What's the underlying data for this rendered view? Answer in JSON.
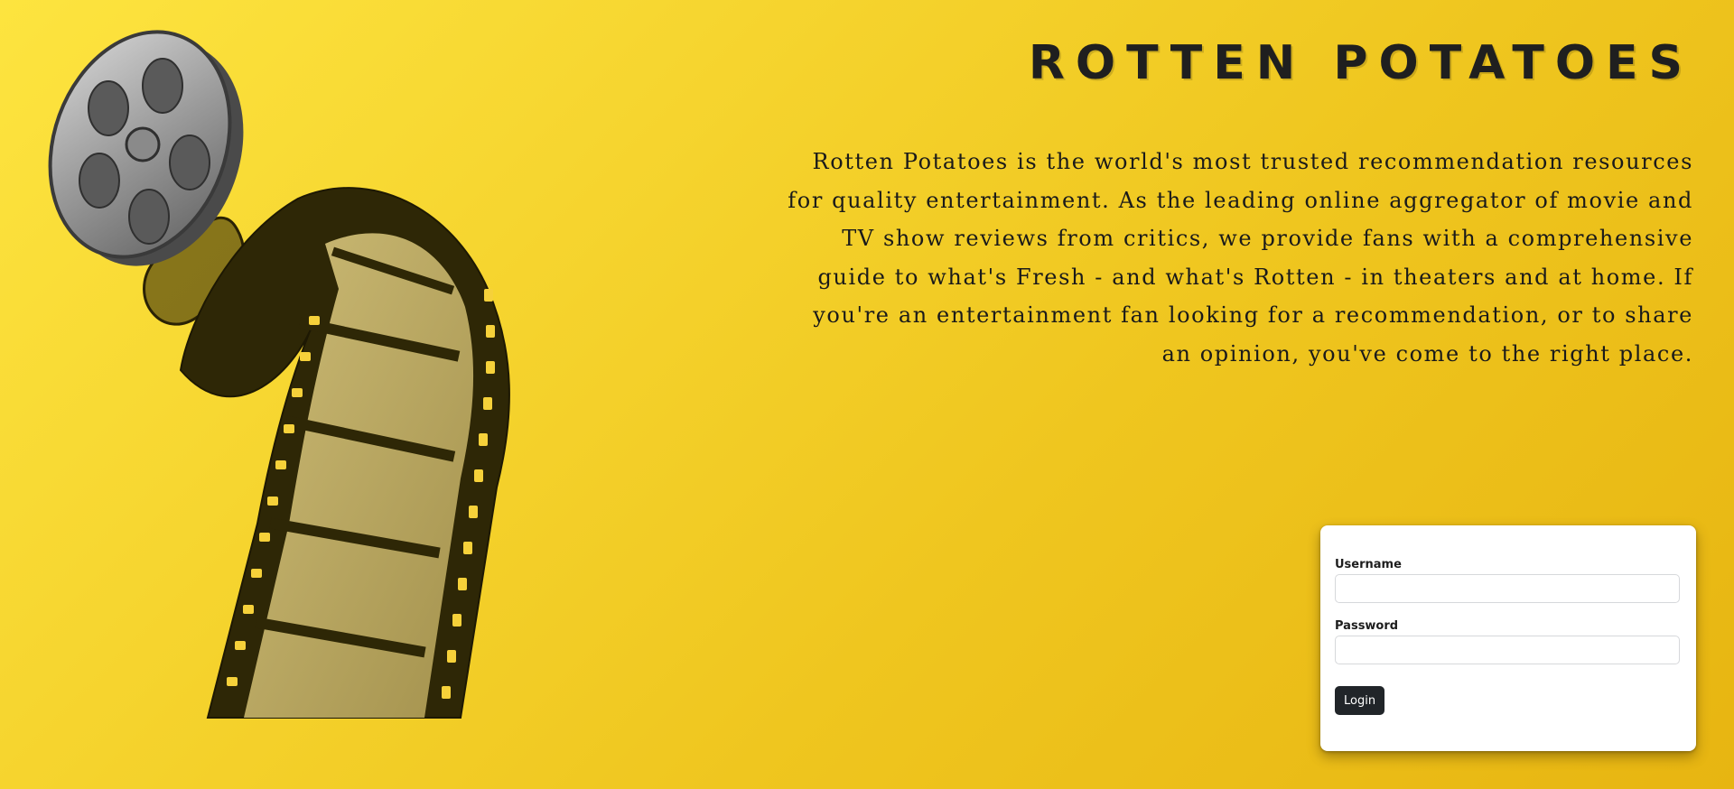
{
  "brand": {
    "title": "ROTTEN POTATOES"
  },
  "about": {
    "text": "Rotten Potatoes is the world's most trusted recommendation resources for quality entertainment. As the leading online aggregator of movie and TV show reviews from critics, we provide fans with a comprehensive guide to what's Fresh - and what's Rotten - in theaters and at home. If you're an entertainment fan looking for a recommendation, or to share an opinion, you've come to the right place."
  },
  "login": {
    "username_label": "Username",
    "username_value": "",
    "password_label": "Password",
    "password_value": "",
    "button_label": "Login"
  },
  "icons": {
    "hero": "film-reel-icon"
  },
  "colors": {
    "background_start": "#fde43f",
    "background_end": "#e7b511",
    "button": "#212529",
    "text": "#1a1a1a"
  }
}
